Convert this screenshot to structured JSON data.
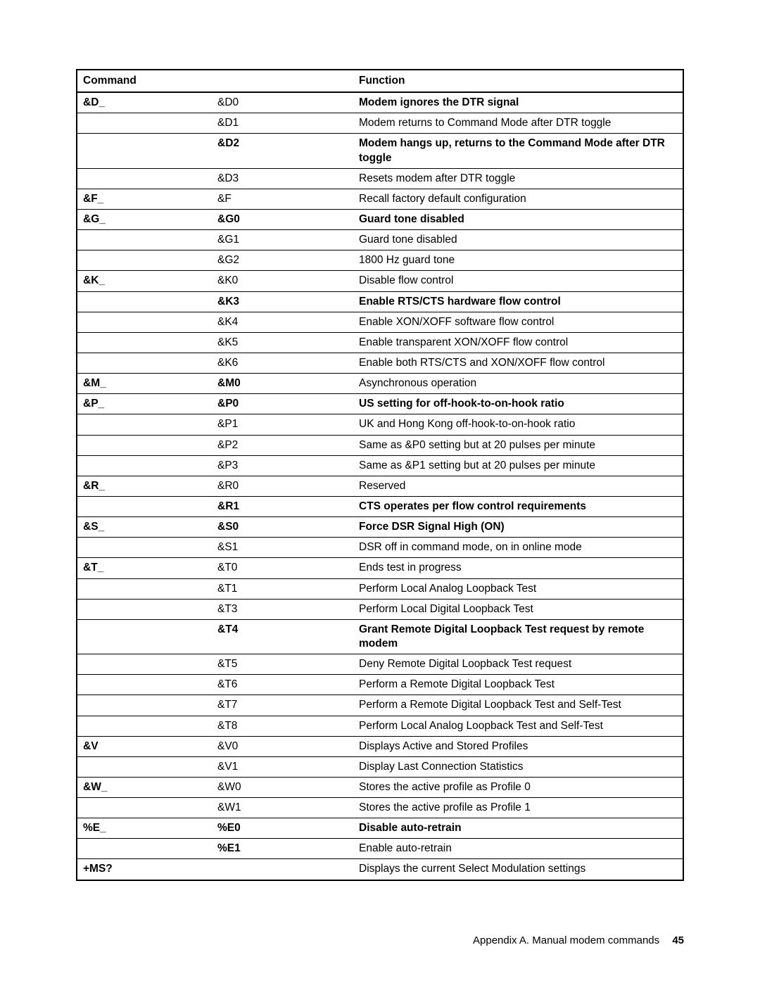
{
  "headers": {
    "command": "Command",
    "function": "Function"
  },
  "rows": [
    {
      "c1": "&D_",
      "c1b": true,
      "c2": "&D0",
      "c2b": false,
      "c3": "Modem ignores the DTR signal",
      "c3b": true
    },
    {
      "c1": "",
      "c1b": false,
      "c2": "&D1",
      "c2b": false,
      "c3": "Modem returns to Command Mode after DTR toggle",
      "c3b": false
    },
    {
      "c1": "",
      "c1b": false,
      "c2": "&D2",
      "c2b": true,
      "c3": "Modem hangs up, returns to the Command Mode after DTR toggle",
      "c3b": true
    },
    {
      "c1": "",
      "c1b": false,
      "c2": "&D3",
      "c2b": false,
      "c3": "Resets modem after DTR toggle",
      "c3b": false
    },
    {
      "c1": "&F_",
      "c1b": true,
      "c2": "&F",
      "c2b": false,
      "c3": "Recall factory default configuration",
      "c3b": false
    },
    {
      "c1": "&G_",
      "c1b": true,
      "c2": "&G0",
      "c2b": true,
      "c3": "Guard tone disabled",
      "c3b": true
    },
    {
      "c1": "",
      "c1b": false,
      "c2": "&G1",
      "c2b": false,
      "c3": "Guard tone disabled",
      "c3b": false
    },
    {
      "c1": "",
      "c1b": false,
      "c2": "&G2",
      "c2b": false,
      "c3": "1800 Hz guard tone",
      "c3b": false
    },
    {
      "c1": "&K_",
      "c1b": true,
      "c2": "&K0",
      "c2b": false,
      "c3": "Disable flow control",
      "c3b": false
    },
    {
      "c1": "",
      "c1b": false,
      "c2": "&K3",
      "c2b": true,
      "c3": "Enable RTS/CTS hardware flow control",
      "c3b": true
    },
    {
      "c1": "",
      "c1b": false,
      "c2": "&K4",
      "c2b": false,
      "c3": "Enable XON/XOFF software flow control",
      "c3b": false
    },
    {
      "c1": "",
      "c1b": false,
      "c2": "&K5",
      "c2b": false,
      "c3": "Enable transparent XON/XOFF flow control",
      "c3b": false
    },
    {
      "c1": "",
      "c1b": false,
      "c2": "&K6",
      "c2b": false,
      "c3": "Enable both RTS/CTS and XON/XOFF flow control",
      "c3b": false
    },
    {
      "c1": "&M_",
      "c1b": true,
      "c2": "&M0",
      "c2b": true,
      "c3": "Asynchronous operation",
      "c3b": false
    },
    {
      "c1": "&P_",
      "c1b": true,
      "c2": "&P0",
      "c2b": true,
      "c3": "US setting for off-hook-to-on-hook ratio",
      "c3b": true
    },
    {
      "c1": "",
      "c1b": false,
      "c2": "&P1",
      "c2b": false,
      "c3": "UK and Hong Kong off-hook-to-on-hook ratio",
      "c3b": false
    },
    {
      "c1": "",
      "c1b": false,
      "c2": "&P2",
      "c2b": false,
      "c3": "Same as &P0 setting but at 20 pulses per minute",
      "c3b": false
    },
    {
      "c1": "",
      "c1b": false,
      "c2": "&P3",
      "c2b": false,
      "c3": "Same as &P1 setting but at 20 pulses per minute",
      "c3b": false
    },
    {
      "c1": "&R_",
      "c1b": true,
      "c2": "&R0",
      "c2b": false,
      "c3": "Reserved",
      "c3b": false
    },
    {
      "c1": "",
      "c1b": false,
      "c2": "&R1",
      "c2b": true,
      "c3": "CTS operates per flow control requirements",
      "c3b": true
    },
    {
      "c1": "&S_",
      "c1b": true,
      "c2": "&S0",
      "c2b": true,
      "c3": "Force DSR Signal High (ON)",
      "c3b": true
    },
    {
      "c1": "",
      "c1b": false,
      "c2": "&S1",
      "c2b": false,
      "c3": "DSR off in command mode, on in online mode",
      "c3b": false
    },
    {
      "c1": "&T_",
      "c1b": true,
      "c2": "&T0",
      "c2b": false,
      "c3": "Ends test in progress",
      "c3b": false
    },
    {
      "c1": "",
      "c1b": false,
      "c2": "&T1",
      "c2b": false,
      "c3": "Perform Local Analog Loopback Test",
      "c3b": false
    },
    {
      "c1": "",
      "c1b": false,
      "c2": "&T3",
      "c2b": false,
      "c3": "Perform Local Digital Loopback Test",
      "c3b": false
    },
    {
      "c1": "",
      "c1b": false,
      "c2": "&T4",
      "c2b": true,
      "c3": "Grant Remote Digital Loopback Test request by remote modem",
      "c3b": true
    },
    {
      "c1": "",
      "c1b": false,
      "c2": "&T5",
      "c2b": false,
      "c3": "Deny Remote Digital Loopback Test request",
      "c3b": false
    },
    {
      "c1": "",
      "c1b": false,
      "c2": "&T6",
      "c2b": false,
      "c3": "Perform a Remote Digital Loopback Test",
      "c3b": false
    },
    {
      "c1": "",
      "c1b": false,
      "c2": "&T7",
      "c2b": false,
      "c3": "Perform a Remote Digital Loopback Test and Self-Test",
      "c3b": false
    },
    {
      "c1": "",
      "c1b": false,
      "c2": "&T8",
      "c2b": false,
      "c3": "Perform Local Analog Loopback Test and Self-Test",
      "c3b": false
    },
    {
      "c1": "&V",
      "c1b": true,
      "c2": "&V0",
      "c2b": false,
      "c3": "Displays Active and Stored Profiles",
      "c3b": false
    },
    {
      "c1": "",
      "c1b": false,
      "c2": "&V1",
      "c2b": false,
      "c3": "Display Last Connection Statistics",
      "c3b": false
    },
    {
      "c1": "&W_",
      "c1b": true,
      "c2": "&W0",
      "c2b": false,
      "c3": "Stores the active profile as Profile 0",
      "c3b": false
    },
    {
      "c1": "",
      "c1b": false,
      "c2": "&W1",
      "c2b": false,
      "c3": "Stores the active profile as Profile 1",
      "c3b": false
    },
    {
      "c1": "%E_",
      "c1b": true,
      "c2": "%E0",
      "c2b": true,
      "c3": "Disable auto-retrain",
      "c3b": true
    },
    {
      "c1": "",
      "c1b": false,
      "c2": "%E1",
      "c2b": true,
      "c3": "Enable auto-retrain",
      "c3b": false
    },
    {
      "c1": "+MS?",
      "c1b": true,
      "c2": "",
      "c2b": false,
      "c3": "Displays the current Select Modulation settings",
      "c3b": false
    }
  ],
  "footer": {
    "text": "Appendix A.  Manual modem commands",
    "page": "45"
  }
}
